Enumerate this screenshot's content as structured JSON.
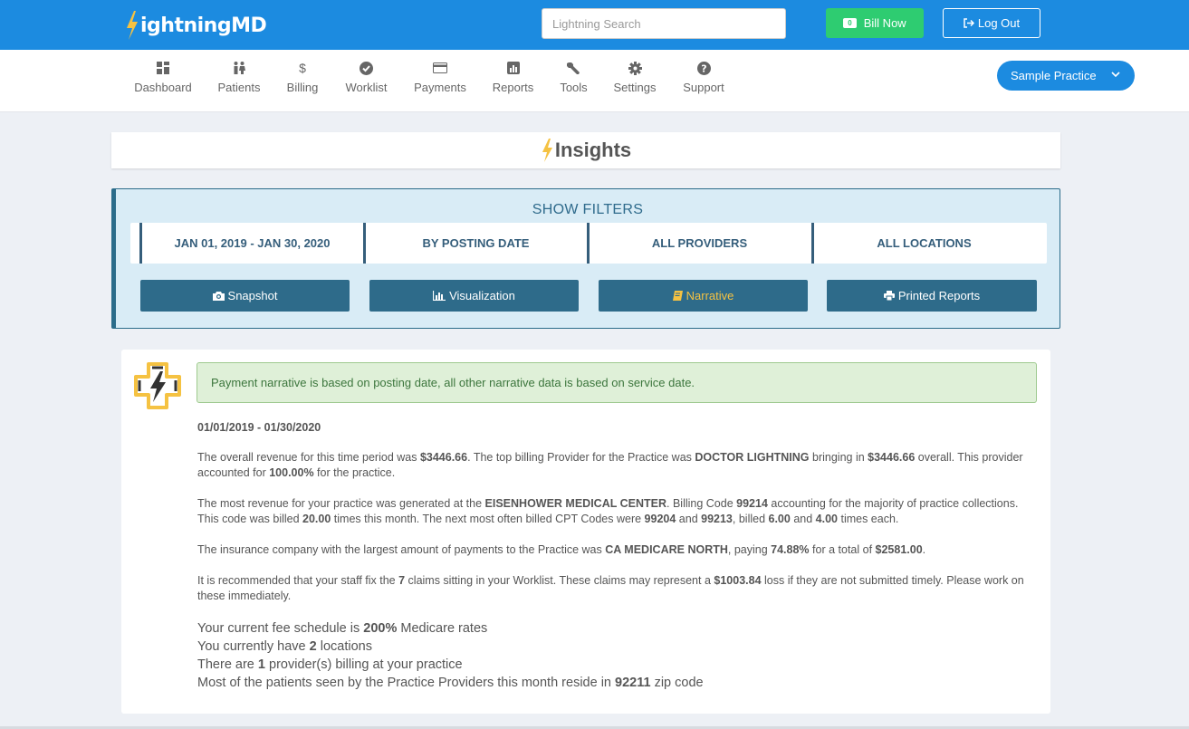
{
  "header": {
    "logo_text": "ightningMD",
    "search_placeholder": "Lightning Search",
    "bill_count": "0",
    "bill_label": "Bill Now",
    "logout_label": "Log Out"
  },
  "nav": {
    "items": [
      {
        "label": "Dashboard",
        "icon": "dashboard-icon"
      },
      {
        "label": "Patients",
        "icon": "patients-icon"
      },
      {
        "label": "Billing",
        "icon": "dollar-icon"
      },
      {
        "label": "Worklist",
        "icon": "check-circle-icon"
      },
      {
        "label": "Payments",
        "icon": "credit-card-icon"
      },
      {
        "label": "Reports",
        "icon": "bar-chart-icon"
      },
      {
        "label": "Tools",
        "icon": "wrench-icon"
      },
      {
        "label": "Settings",
        "icon": "gear-icon"
      },
      {
        "label": "Support",
        "icon": "question-circle-icon"
      }
    ],
    "practice_label": "Sample Practice"
  },
  "insights": {
    "title": "Insights"
  },
  "filters": {
    "title": "SHOW FILTERS",
    "cells": [
      "JAN 01, 2019 - JAN 30, 2020",
      "BY POSTING DATE",
      "ALL PROVIDERS",
      "ALL LOCATIONS"
    ],
    "buttons": [
      {
        "label": "Snapshot",
        "icon": "camera-icon"
      },
      {
        "label": "Visualization",
        "icon": "bar-chart-icon"
      },
      {
        "label": "Narrative",
        "icon": "book-icon"
      },
      {
        "label": "Printed Reports",
        "icon": "print-icon"
      }
    ],
    "active": "Narrative"
  },
  "narrative": {
    "alert": "Payment narrative is based on posting date, all other narrative data is based on service date.",
    "date_range": "01/01/2019 - 01/30/2020",
    "p1": {
      "t1": "The overall revenue for this time period was ",
      "revenue": "$3446.66",
      "t2": ". The top billing Provider for the Practice was ",
      "provider": "DOCTOR LIGHTNING",
      "t3": " bringing in ",
      "provider_amount": "$3446.66",
      "t4": " overall. This provider accounted for ",
      "provider_pct": "100.00%",
      "t5": " for the practice."
    },
    "p2": {
      "t1": "The most revenue for your practice was generated at the ",
      "location": "EISENHOWER MEDICAL CENTER",
      "t2": ". Billing Code ",
      "code": "99214",
      "t3": " accounting for the majority of practice collections. This code was billed ",
      "times": "20.00",
      "t4": " times this month. The next most often billed CPT Codes were ",
      "code2": "99204",
      "t5": " and ",
      "code3": "99213",
      "t6": ", billed ",
      "times2": "6.00",
      "t7": " and ",
      "times3": "4.00",
      "t8": " times each."
    },
    "p3": {
      "t1": "The insurance company with the largest amount of payments to the Practice was ",
      "insurer": "CA MEDICARE NORTH",
      "t2": ", paying ",
      "pct": "74.88%",
      "t3": " for a total of ",
      "total": "$2581.00",
      "t4": "."
    },
    "p4": {
      "t1": "It is recommended that your staff fix the ",
      "claims": "7",
      "t2": " claims sitting in your Worklist. These claims may represent a ",
      "loss": "$1003.84",
      "t3": " loss if they are not submitted timely. Please work on these immediately."
    },
    "stats": {
      "fee_t1": "Your current fee schedule is ",
      "fee_pct": "200%",
      "fee_t2": " Medicare rates",
      "loc_t1": "You currently have ",
      "loc_count": "2",
      "loc_t2": " locations",
      "prov_t1": "There are ",
      "prov_count": "1",
      "prov_t2": " provider(s) billing at your practice",
      "zip_t1": "Most of the patients seen by the Practice Providers this month reside in ",
      "zip": "92211",
      "zip_t2": " zip code"
    }
  },
  "colors": {
    "brand_blue": "#1c8be0",
    "bill_green": "#2ecc71",
    "filter_blue": "#2e6b8a",
    "alert_green": "#dff0d8"
  }
}
